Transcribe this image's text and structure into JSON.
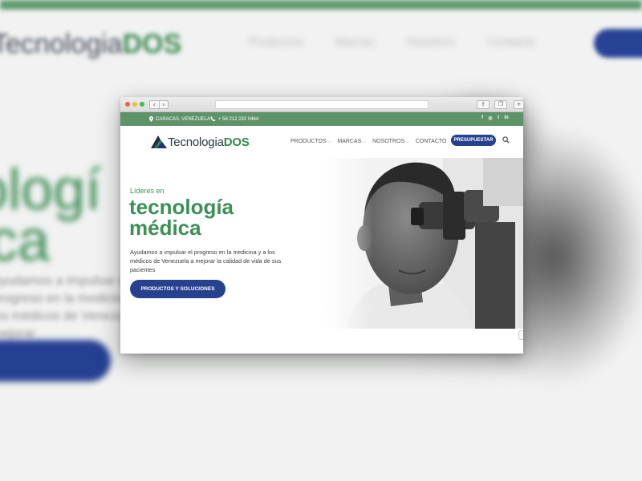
{
  "background": {
    "logo_prefix": "Tecnologia",
    "logo_suffix": "DOS",
    "menu": [
      "Productos",
      "Marcas",
      "Nosotros",
      "Contacto"
    ],
    "title_line1": "nologí",
    "title_line2": "dica",
    "text": "Ayudamos a impulsar el progreso en la medicina y a los médicos de Venezuela a mejorar",
    "colors": {
      "green": "#3a8a51",
      "blue": "#253f92"
    }
  },
  "browser": {
    "controls": {
      "back_icon": "‹",
      "forward_icon": "›",
      "share_icon": "⇪",
      "tabs_icon": "❐",
      "plus_icon": "+"
    },
    "topbar": {
      "location": "CARACAS, VENEZUELA",
      "phone": "+ 58 212 232 0464",
      "social": [
        "f",
        "◎",
        "t",
        "in"
      ]
    },
    "header": {
      "logo_prefix": "Tecnologia",
      "logo_suffix": "DOS",
      "menu": [
        {
          "label": "PRODUCTOS",
          "dropdown": true
        },
        {
          "label": "MARCAS",
          "dropdown": true
        },
        {
          "label": "NOSOTROS",
          "dropdown": true
        },
        {
          "label": "CONTACTO",
          "dropdown": false
        }
      ],
      "cta": "PRESUPUESTAR"
    },
    "hero": {
      "kicker": "Líderes en",
      "title_line1": "tecnología",
      "title_line2": "médica",
      "description": "Ayudamos a impulsar el progreso en la medicina y a los médicos de Venezuela a mejorar la calidad de vida de sus pacientes",
      "button": "PRODUCTOS Y SOLUCIONES"
    },
    "colors": {
      "green": "#3c8f55",
      "topbar": "#5e9368",
      "blue": "#27418f"
    }
  }
}
